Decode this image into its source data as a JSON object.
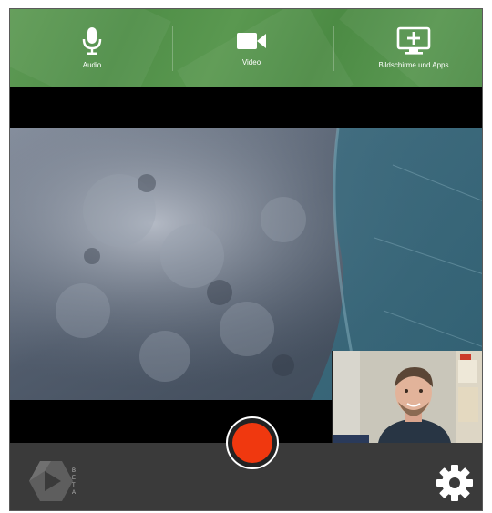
{
  "toolbar": {
    "audio_label": "Audio",
    "video_label": "Video",
    "screens_label": "Bildschirme und Apps",
    "icons": [
      "microphone-icon",
      "video-camera-icon",
      "add-screen-icon"
    ]
  },
  "logo": {
    "beta_letters": [
      "B",
      "E",
      "T",
      "A"
    ]
  },
  "colors": {
    "toolbar_green": "#5a9850",
    "record_red": "#f0380f",
    "bottom_bar": "#3a3a3a"
  },
  "icons": {
    "settings": "gear-icon",
    "record": "record-button"
  }
}
